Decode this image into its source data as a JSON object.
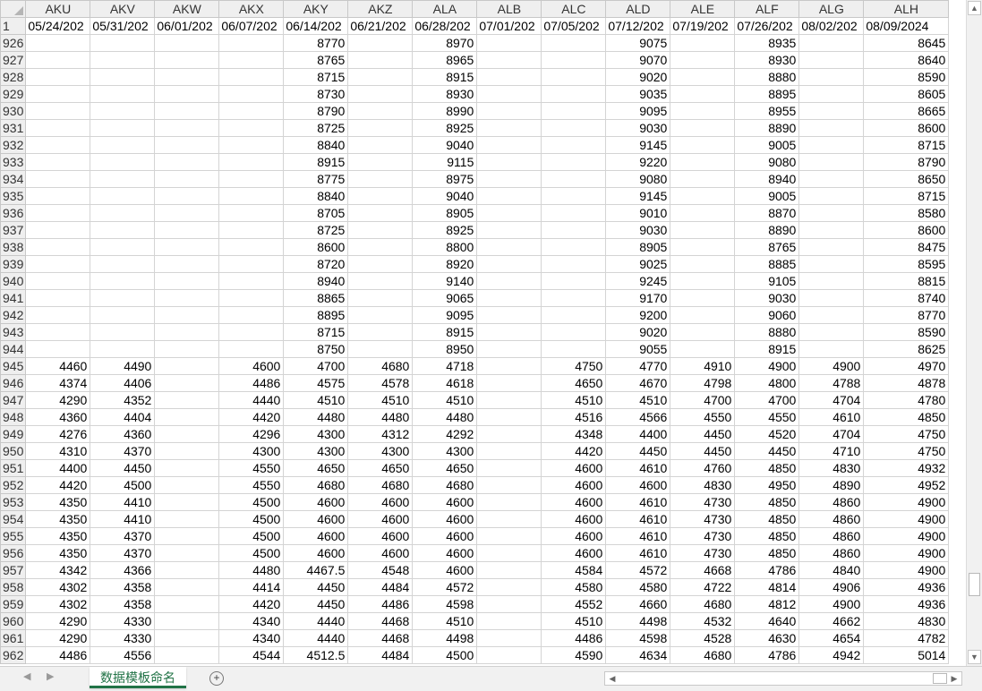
{
  "column_letters": [
    "AKU",
    "AKV",
    "AKW",
    "AKX",
    "AKY",
    "AKZ",
    "ALA",
    "ALB",
    "ALC",
    "ALD",
    "ALE",
    "ALF",
    "ALG",
    "ALH"
  ],
  "header_row": {
    "row_number": "1",
    "values": [
      "05/24/202",
      "05/31/202",
      "06/01/202",
      "06/07/202",
      "06/14/202",
      "06/21/202",
      "06/28/202",
      "07/01/202",
      "07/05/202",
      "07/12/202",
      "07/19/202",
      "07/26/202",
      "08/02/202",
      "08/09/2024"
    ]
  },
  "rows": [
    {
      "n": "926",
      "c": [
        "",
        "",
        "",
        "",
        "8770",
        "",
        "8970",
        "",
        "",
        "9075",
        "",
        "8935",
        "",
        "8645"
      ]
    },
    {
      "n": "927",
      "c": [
        "",
        "",
        "",
        "",
        "8765",
        "",
        "8965",
        "",
        "",
        "9070",
        "",
        "8930",
        "",
        "8640"
      ]
    },
    {
      "n": "928",
      "c": [
        "",
        "",
        "",
        "",
        "8715",
        "",
        "8915",
        "",
        "",
        "9020",
        "",
        "8880",
        "",
        "8590"
      ]
    },
    {
      "n": "929",
      "c": [
        "",
        "",
        "",
        "",
        "8730",
        "",
        "8930",
        "",
        "",
        "9035",
        "",
        "8895",
        "",
        "8605"
      ]
    },
    {
      "n": "930",
      "c": [
        "",
        "",
        "",
        "",
        "8790",
        "",
        "8990",
        "",
        "",
        "9095",
        "",
        "8955",
        "",
        "8665"
      ]
    },
    {
      "n": "931",
      "c": [
        "",
        "",
        "",
        "",
        "8725",
        "",
        "8925",
        "",
        "",
        "9030",
        "",
        "8890",
        "",
        "8600"
      ]
    },
    {
      "n": "932",
      "c": [
        "",
        "",
        "",
        "",
        "8840",
        "",
        "9040",
        "",
        "",
        "9145",
        "",
        "9005",
        "",
        "8715"
      ]
    },
    {
      "n": "933",
      "c": [
        "",
        "",
        "",
        "",
        "8915",
        "",
        "9115",
        "",
        "",
        "9220",
        "",
        "9080",
        "",
        "8790"
      ]
    },
    {
      "n": "934",
      "c": [
        "",
        "",
        "",
        "",
        "8775",
        "",
        "8975",
        "",
        "",
        "9080",
        "",
        "8940",
        "",
        "8650"
      ]
    },
    {
      "n": "935",
      "c": [
        "",
        "",
        "",
        "",
        "8840",
        "",
        "9040",
        "",
        "",
        "9145",
        "",
        "9005",
        "",
        "8715"
      ]
    },
    {
      "n": "936",
      "c": [
        "",
        "",
        "",
        "",
        "8705",
        "",
        "8905",
        "",
        "",
        "9010",
        "",
        "8870",
        "",
        "8580"
      ]
    },
    {
      "n": "937",
      "c": [
        "",
        "",
        "",
        "",
        "8725",
        "",
        "8925",
        "",
        "",
        "9030",
        "",
        "8890",
        "",
        "8600"
      ]
    },
    {
      "n": "938",
      "c": [
        "",
        "",
        "",
        "",
        "8600",
        "",
        "8800",
        "",
        "",
        "8905",
        "",
        "8765",
        "",
        "8475"
      ]
    },
    {
      "n": "939",
      "c": [
        "",
        "",
        "",
        "",
        "8720",
        "",
        "8920",
        "",
        "",
        "9025",
        "",
        "8885",
        "",
        "8595"
      ]
    },
    {
      "n": "940",
      "c": [
        "",
        "",
        "",
        "",
        "8940",
        "",
        "9140",
        "",
        "",
        "9245",
        "",
        "9105",
        "",
        "8815"
      ]
    },
    {
      "n": "941",
      "c": [
        "",
        "",
        "",
        "",
        "8865",
        "",
        "9065",
        "",
        "",
        "9170",
        "",
        "9030",
        "",
        "8740"
      ]
    },
    {
      "n": "942",
      "c": [
        "",
        "",
        "",
        "",
        "8895",
        "",
        "9095",
        "",
        "",
        "9200",
        "",
        "9060",
        "",
        "8770"
      ]
    },
    {
      "n": "943",
      "c": [
        "",
        "",
        "",
        "",
        "8715",
        "",
        "8915",
        "",
        "",
        "9020",
        "",
        "8880",
        "",
        "8590"
      ]
    },
    {
      "n": "944",
      "c": [
        "",
        "",
        "",
        "",
        "8750",
        "",
        "8950",
        "",
        "",
        "9055",
        "",
        "8915",
        "",
        "8625"
      ]
    },
    {
      "n": "945",
      "c": [
        "4460",
        "4490",
        "",
        "4600",
        "4700",
        "4680",
        "4718",
        "",
        "4750",
        "4770",
        "4910",
        "4900",
        "4900",
        "4970"
      ]
    },
    {
      "n": "946",
      "c": [
        "4374",
        "4406",
        "",
        "4486",
        "4575",
        "4578",
        "4618",
        "",
        "4650",
        "4670",
        "4798",
        "4800",
        "4788",
        "4878"
      ]
    },
    {
      "n": "947",
      "c": [
        "4290",
        "4352",
        "",
        "4440",
        "4510",
        "4510",
        "4510",
        "",
        "4510",
        "4510",
        "4700",
        "4700",
        "4704",
        "4780"
      ]
    },
    {
      "n": "948",
      "c": [
        "4360",
        "4404",
        "",
        "4420",
        "4480",
        "4480",
        "4480",
        "",
        "4516",
        "4566",
        "4550",
        "4550",
        "4610",
        "4850"
      ]
    },
    {
      "n": "949",
      "c": [
        "4276",
        "4360",
        "",
        "4296",
        "4300",
        "4312",
        "4292",
        "",
        "4348",
        "4400",
        "4450",
        "4520",
        "4704",
        "4750"
      ]
    },
    {
      "n": "950",
      "c": [
        "4310",
        "4370",
        "",
        "4300",
        "4300",
        "4300",
        "4300",
        "",
        "4420",
        "4450",
        "4450",
        "4450",
        "4710",
        "4750"
      ]
    },
    {
      "n": "951",
      "c": [
        "4400",
        "4450",
        "",
        "4550",
        "4650",
        "4650",
        "4650",
        "",
        "4600",
        "4610",
        "4760",
        "4850",
        "4830",
        "4932"
      ]
    },
    {
      "n": "952",
      "c": [
        "4420",
        "4500",
        "",
        "4550",
        "4680",
        "4680",
        "4680",
        "",
        "4600",
        "4600",
        "4830",
        "4950",
        "4890",
        "4952"
      ]
    },
    {
      "n": "953",
      "c": [
        "4350",
        "4410",
        "",
        "4500",
        "4600",
        "4600",
        "4600",
        "",
        "4600",
        "4610",
        "4730",
        "4850",
        "4860",
        "4900"
      ]
    },
    {
      "n": "954",
      "c": [
        "4350",
        "4410",
        "",
        "4500",
        "4600",
        "4600",
        "4600",
        "",
        "4600",
        "4610",
        "4730",
        "4850",
        "4860",
        "4900"
      ]
    },
    {
      "n": "955",
      "c": [
        "4350",
        "4370",
        "",
        "4500",
        "4600",
        "4600",
        "4600",
        "",
        "4600",
        "4610",
        "4730",
        "4850",
        "4860",
        "4900"
      ]
    },
    {
      "n": "956",
      "c": [
        "4350",
        "4370",
        "",
        "4500",
        "4600",
        "4600",
        "4600",
        "",
        "4600",
        "4610",
        "4730",
        "4850",
        "4860",
        "4900"
      ]
    },
    {
      "n": "957",
      "c": [
        "4342",
        "4366",
        "",
        "4480",
        "4467.5",
        "4548",
        "4600",
        "",
        "4584",
        "4572",
        "4668",
        "4786",
        "4840",
        "4900"
      ]
    },
    {
      "n": "958",
      "c": [
        "4302",
        "4358",
        "",
        "4414",
        "4450",
        "4484",
        "4572",
        "",
        "4580",
        "4580",
        "4722",
        "4814",
        "4906",
        "4936"
      ]
    },
    {
      "n": "959",
      "c": [
        "4302",
        "4358",
        "",
        "4420",
        "4450",
        "4486",
        "4598",
        "",
        "4552",
        "4660",
        "4680",
        "4812",
        "4900",
        "4936"
      ]
    },
    {
      "n": "960",
      "c": [
        "4290",
        "4330",
        "",
        "4340",
        "4440",
        "4468",
        "4510",
        "",
        "4510",
        "4498",
        "4532",
        "4640",
        "4662",
        "4830"
      ]
    },
    {
      "n": "961",
      "c": [
        "4290",
        "4330",
        "",
        "4340",
        "4440",
        "4468",
        "4498",
        "",
        "4486",
        "4598",
        "4528",
        "4630",
        "4654",
        "4782"
      ]
    },
    {
      "n": "962",
      "c": [
        "4486",
        "4556",
        "",
        "4544",
        "4512.5",
        "4484",
        "4500",
        "",
        "4590",
        "4634",
        "4680",
        "4786",
        "4942",
        "5014"
      ]
    }
  ],
  "sheet_tab": "数据模板命名",
  "icons": {
    "add_sheet": "plus-circle-icon",
    "scroll_up": "triangle-up-icon",
    "scroll_down": "triangle-down-icon",
    "scroll_left": "triangle-left-icon",
    "scroll_right": "triangle-right-icon"
  },
  "colors": {
    "tab_accent": "#217346",
    "header_bg": "#efefef",
    "gridline": "#d4d4d4"
  }
}
